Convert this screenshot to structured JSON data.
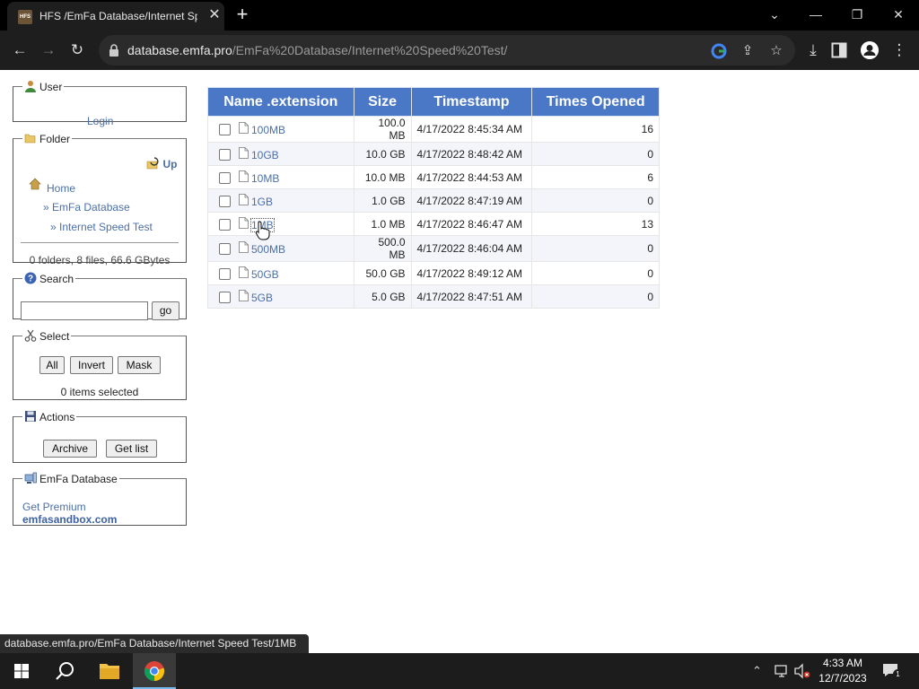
{
  "browser": {
    "tab_title": "HFS /EmFa Database/Internet Speed Test/",
    "favicon_text": "HFS",
    "url_host": "database.emfa.pro",
    "url_path": "/EmFa%20Database/Internet%20Speed%20Test/"
  },
  "sidebar": {
    "user": {
      "legend": "User",
      "login": "Login"
    },
    "folder": {
      "legend": "Folder",
      "up": "Up",
      "home": "Home",
      "crumb1": "» EmFa Database",
      "crumb2": "» Internet Speed Test",
      "summary": "0 folders, 8 files, 66.6 GBytes"
    },
    "search": {
      "legend": "Search",
      "placeholder": "",
      "go": "go"
    },
    "select": {
      "legend": "Select",
      "all": "All",
      "invert": "Invert",
      "mask": "Mask",
      "status": "0 items selected"
    },
    "actions": {
      "legend": "Actions",
      "archive": "Archive",
      "getlist": "Get list"
    },
    "emfa": {
      "legend": "EmFa Database",
      "premium": "Get Premium",
      "sandbox": "emfasandbox.com"
    }
  },
  "table": {
    "headers": [
      "Name .extension",
      "Size",
      "Timestamp",
      "Times Opened"
    ],
    "rows": [
      {
        "name": "100MB",
        "size": "100.0 MB",
        "timestamp": "4/17/2022 8:45:34 AM",
        "opened": "16"
      },
      {
        "name": "10GB",
        "size": "10.0 GB",
        "timestamp": "4/17/2022 8:48:42 AM",
        "opened": "0"
      },
      {
        "name": "10MB",
        "size": "10.0 MB",
        "timestamp": "4/17/2022 8:44:53 AM",
        "opened": "6"
      },
      {
        "name": "1GB",
        "size": "1.0 GB",
        "timestamp": "4/17/2022 8:47:19 AM",
        "opened": "0"
      },
      {
        "name": "1MB",
        "size": "1.0 MB",
        "timestamp": "4/17/2022 8:46:47 AM",
        "opened": "13"
      },
      {
        "name": "500MB",
        "size": "500.0 MB",
        "timestamp": "4/17/2022 8:46:04 AM",
        "opened": "0"
      },
      {
        "name": "50GB",
        "size": "50.0 GB",
        "timestamp": "4/17/2022 8:49:12 AM",
        "opened": "0"
      },
      {
        "name": "5GB",
        "size": "5.0 GB",
        "timestamp": "4/17/2022 8:47:51 AM",
        "opened": "0"
      }
    ]
  },
  "statusbar": {
    "text": "database.emfa.pro/EmFa Database/Internet Speed Test/1MB"
  },
  "taskbar": {
    "time": "4:33 AM",
    "date": "12/7/2023",
    "notif_count": "1"
  },
  "colors": {
    "header_blue": "#4a78c6",
    "link_blue": "#4b6fa8"
  }
}
